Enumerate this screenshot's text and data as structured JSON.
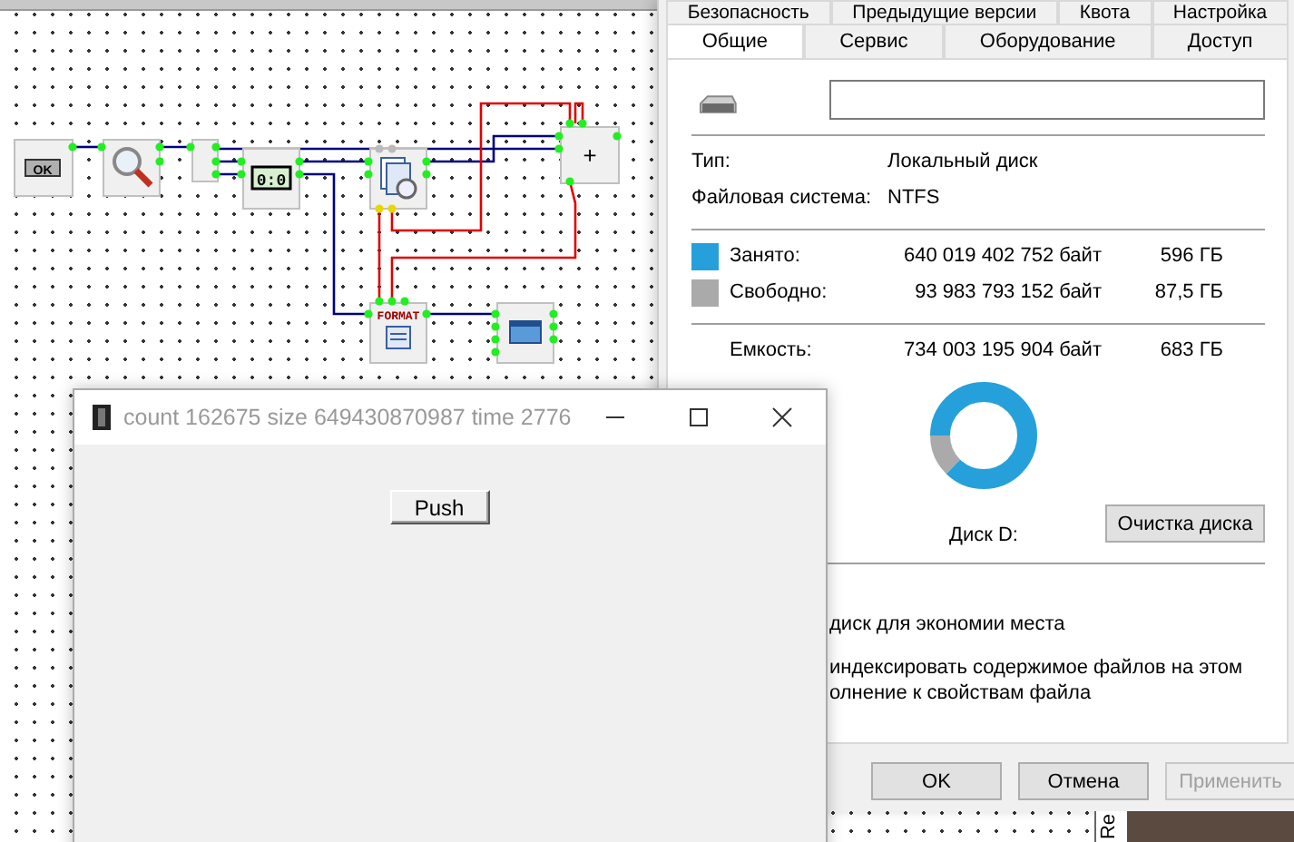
{
  "editor": {
    "nodes": [
      {
        "kind": "ok-button",
        "label": "OK"
      },
      {
        "kind": "magnifier"
      },
      {
        "kind": "splitter"
      },
      {
        "kind": "timer",
        "label": "0:0"
      },
      {
        "kind": "document"
      },
      {
        "kind": "plus",
        "label": "+"
      },
      {
        "kind": "format",
        "label": "FORMAT"
      },
      {
        "kind": "window"
      }
    ]
  },
  "properties_dialog": {
    "tabs_back": [
      {
        "label": "Безопасность",
        "selected": false
      },
      {
        "label": "Предыдущие версии",
        "selected": false
      },
      {
        "label": "Квота",
        "selected": false
      },
      {
        "label": "Настройка",
        "selected": false
      }
    ],
    "tabs": [
      {
        "label": "Общие",
        "selected": true
      },
      {
        "label": "Сервис",
        "selected": false
      },
      {
        "label": "Оборудование",
        "selected": false
      },
      {
        "label": "Доступ",
        "selected": false
      }
    ],
    "info": [
      {
        "label": "Тип:",
        "value": "Локальный диск"
      },
      {
        "label": "Файловая система:",
        "value": "NTFS"
      }
    ],
    "usage": [
      {
        "label": "Занято:",
        "bytes": "640 019 402 752 байт",
        "size": "596 ГБ",
        "color": "#26a0da"
      },
      {
        "label": "Свободно:",
        "bytes": "93 983 793 152 байт",
        "size": "87,5 ГБ",
        "color": "#aaaaaa"
      }
    ],
    "capacity": {
      "label": "Емкость:",
      "bytes": "734 003 195 904 байт",
      "size": "683 ГБ"
    },
    "disk_label": "Диск D:",
    "cleanup_button": "Очистка диска",
    "options": [
      "диск для экономии места",
      "индексировать содержимое файлов на этом",
      "олнение к свойствам файла"
    ],
    "buttons": [
      {
        "label": "OK",
        "disabled": false
      },
      {
        "label": "Отмена",
        "disabled": false
      },
      {
        "label": "Применить",
        "disabled": true
      }
    ]
  },
  "app_window": {
    "title": "count 162675 size 649430870987 time 2776",
    "button": "Push"
  },
  "side_strip": {
    "label": "Re"
  }
}
